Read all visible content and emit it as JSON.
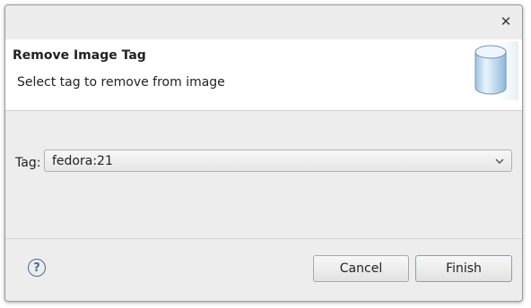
{
  "dialog": {
    "close_icon": "close-icon",
    "banner": {
      "title": "Remove Image Tag",
      "message": "Select tag to remove from image",
      "icon": "image-cylinder-icon"
    },
    "tag_field": {
      "label": "Tag:",
      "selected_value": "fedora:21"
    },
    "buttons": {
      "help_icon": "help-icon",
      "cancel_label": "Cancel",
      "finish_label": "Finish"
    }
  }
}
